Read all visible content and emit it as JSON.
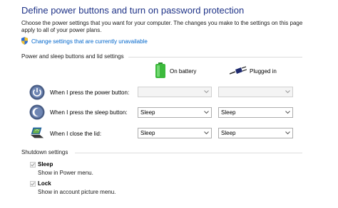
{
  "page": {
    "title": "Define power buttons and turn on password protection",
    "description": "Choose the power settings that you want for your computer. The changes you make to the settings on this page apply to all of your power plans.",
    "change_link": "Change settings that are currently unavailable"
  },
  "power_section": {
    "title": "Power and sleep buttons and lid settings",
    "columns": {
      "battery": "On battery",
      "plugged": "Plugged in"
    },
    "rows": [
      {
        "label": "When I press the power button:",
        "icon": "power-icon",
        "on_battery": "",
        "plugged_in": "",
        "disabled": true
      },
      {
        "label": "When I press the sleep button:",
        "icon": "sleep-moon-icon",
        "on_battery": "Sleep",
        "plugged_in": "Sleep",
        "disabled": false
      },
      {
        "label": "When I close the lid:",
        "icon": "laptop-lid-icon",
        "on_battery": "Sleep",
        "plugged_in": "Sleep",
        "disabled": false
      }
    ]
  },
  "shutdown_section": {
    "title": "Shutdown settings",
    "items": [
      {
        "label": "Sleep",
        "description": "Show in Power menu.",
        "checked": true
      },
      {
        "label": "Lock",
        "description": "Show in account picture menu.",
        "checked": true
      }
    ]
  },
  "colors": {
    "title": "#1e3287",
    "link": "#0066cc",
    "battery_green": "#3cb93c",
    "divider": "#dcdcdc"
  }
}
